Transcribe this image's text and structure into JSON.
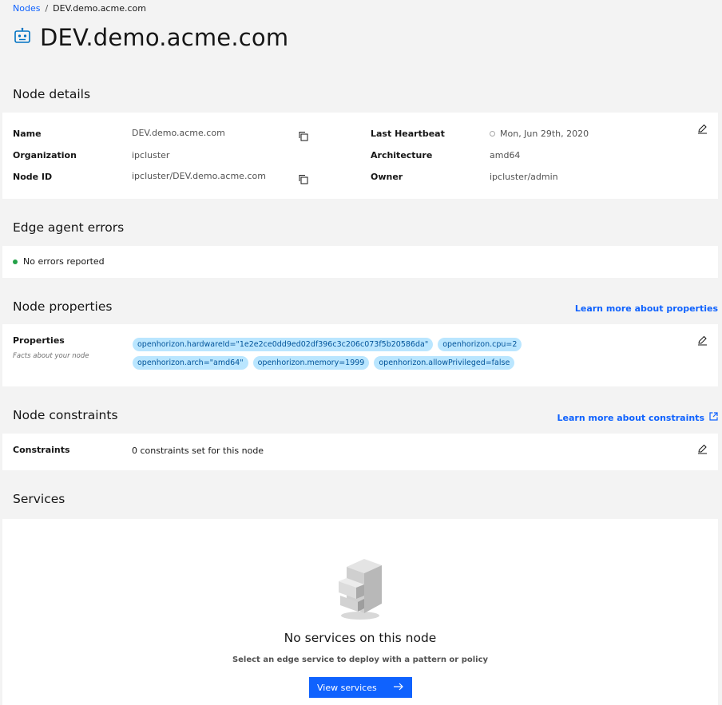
{
  "breadcrumb": {
    "parent": "Nodes",
    "separator": "/",
    "current": "DEV.demo.acme.com"
  },
  "page": {
    "title": "DEV.demo.acme.com"
  },
  "node_details": {
    "section_title": "Node details",
    "name_label": "Name",
    "name_value": "DEV.demo.acme.com",
    "organization_label": "Organization",
    "organization_value": "ipcluster",
    "node_id_label": "Node ID",
    "node_id_value": "ipcluster/DEV.demo.acme.com",
    "heartbeat_label": "Last Heartbeat",
    "heartbeat_value": "Mon, Jun 29th, 2020",
    "architecture_label": "Architecture",
    "architecture_value": "amd64",
    "owner_label": "Owner",
    "owner_value": "ipcluster/admin"
  },
  "agent_errors": {
    "section_title": "Edge agent errors",
    "status_text": "No errors reported",
    "status_color": "#24a148"
  },
  "node_properties": {
    "section_title": "Node properties",
    "learn_more": "Learn more about properties",
    "label": "Properties",
    "helper": "Facts about your node",
    "tags": [
      "openhorizon.hardwareId=\"1e2e2ce0dd9ed02df396c3c206c073f5b20586da\"",
      "openhorizon.cpu=2",
      "openhorizon.arch=\"amd64\"",
      "openhorizon.memory=1999",
      "openhorizon.allowPrivileged=false"
    ]
  },
  "node_constraints": {
    "section_title": "Node constraints",
    "learn_more": "Learn more about constraints",
    "label": "Constraints",
    "value": "0 constraints set for this node"
  },
  "services": {
    "section_title": "Services",
    "empty_title": "No services on this node",
    "empty_subtitle": "Select an edge service to deploy with a pattern or policy",
    "button_label": "View services"
  },
  "colors": {
    "accent": "#0f62fe",
    "tag_bg": "#bae6ff",
    "tag_text": "#00539a"
  }
}
